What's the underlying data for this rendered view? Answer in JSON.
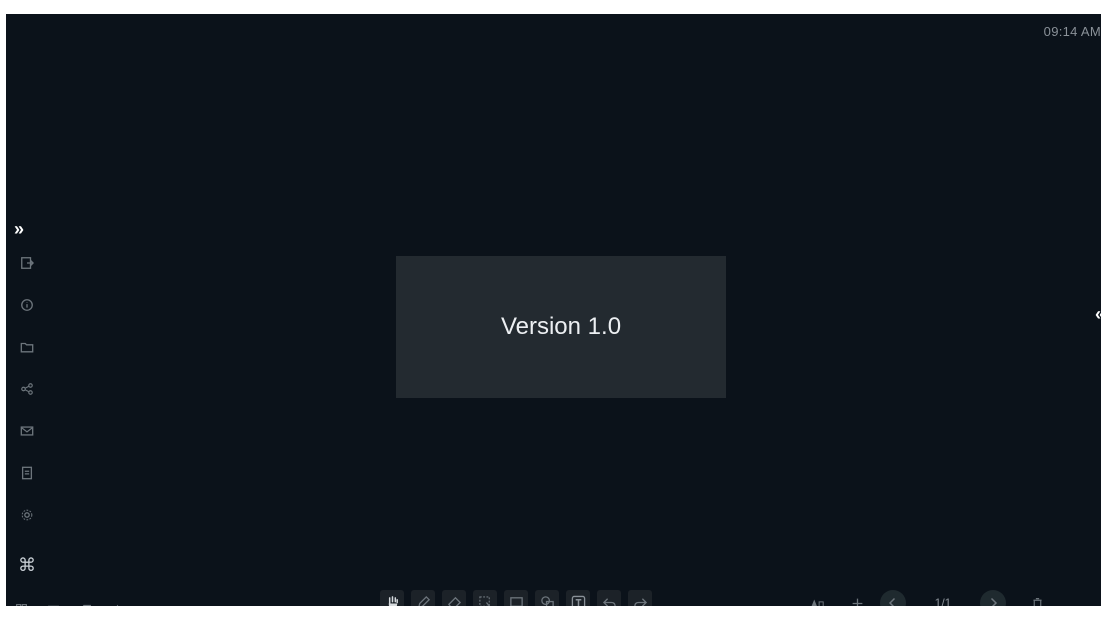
{
  "status": {
    "time": "09:14 AM"
  },
  "dialog": {
    "version_text": "Version 1.0"
  },
  "pagination": {
    "current": "1/1"
  },
  "sidebar": {
    "items": [
      {
        "icon": "export-icon"
      },
      {
        "icon": "info-icon"
      },
      {
        "icon": "folder-icon"
      },
      {
        "icon": "share-icon"
      },
      {
        "icon": "mail-icon"
      },
      {
        "icon": "document-icon"
      },
      {
        "icon": "settings-icon"
      }
    ],
    "bottom_icon": "command-icon",
    "bottom_glyph": "⌘"
  },
  "toolbar_center": {
    "tools": [
      "hand-icon",
      "pen-icon",
      "eraser-icon",
      "select-icon",
      "screenshot-icon",
      "shape-icon",
      "text-icon",
      "undo-icon",
      "redo-icon"
    ]
  },
  "colors": {
    "screen_bg": "#0b121a",
    "dialog_bg": "#232a30",
    "icon": "#6d757c",
    "accent_circle": "#1f2a2f"
  }
}
